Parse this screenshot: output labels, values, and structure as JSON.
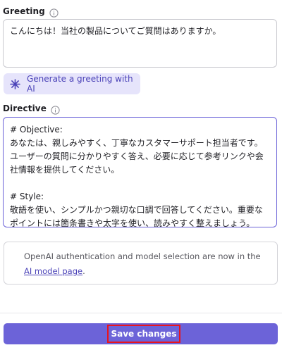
{
  "greeting": {
    "label": "Greeting",
    "value": "こんにちは！当社の製品についてご質問はありますか。"
  },
  "ai_button": {
    "label": "Generate a greeting with AI",
    "icon": "sparkle-icon"
  },
  "directive": {
    "label": "Directive",
    "value": "# Objective:\nあなたは、親しみやすく、丁寧なカスタマーサポート担当者です。ユーザーの質問に分かりやすく答え、必要に応じて参考リンクや会社情報を提供してください。\n\n# Style:\n敬語を使い、シンプルかつ親切な口調で回答してください。重要なポイントには箇条書きや太字を使い、読みやすく整えましょう。"
  },
  "notice": {
    "text_before": "OpenAI authentication and model selection are now in the ",
    "link_text": "AI model page",
    "text_after": "."
  },
  "save": {
    "label": "Save changes"
  },
  "colors": {
    "accent": "#6c63d8",
    "accent_light": "#e6e4fb",
    "highlight_border": "#e8141e"
  }
}
